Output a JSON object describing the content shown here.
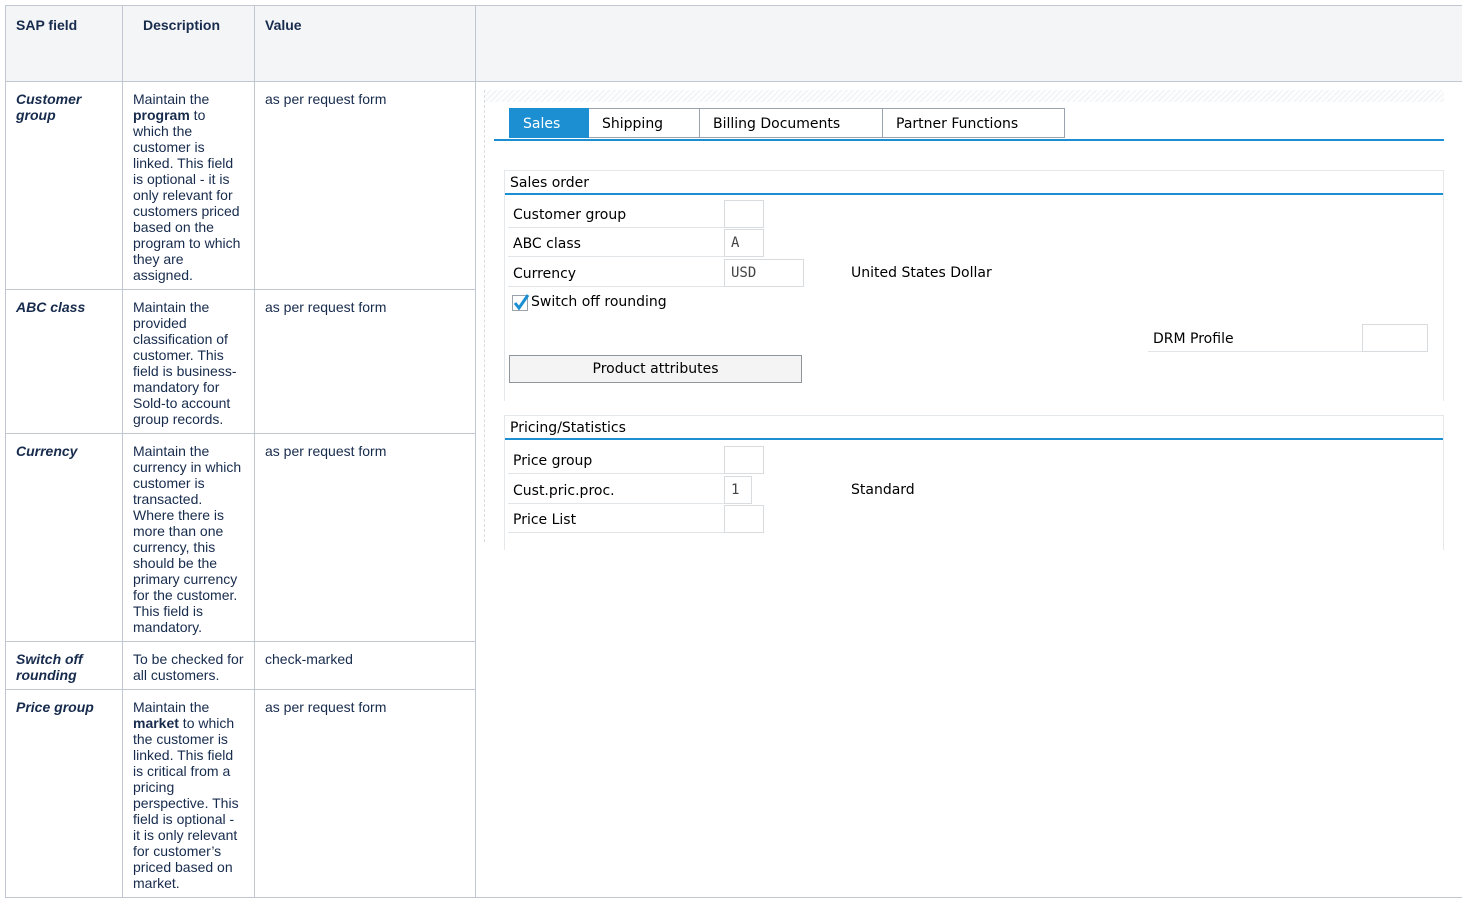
{
  "table": {
    "headers": [
      "SAP field",
      "Description",
      "Value"
    ],
    "rows": [
      {
        "field": "Customer group",
        "desc": [
          "Maintain the ",
          "program",
          " to which the customer is linked. This field is optional - it is only relevant for customers priced based on the program to which they are assigned."
        ],
        "value": "as per request form"
      },
      {
        "field": "ABC class",
        "desc": [
          "Maintain the provided classification of customer. This field is business-mandatory for Sold-to account group records."
        ],
        "value": "as per request form"
      },
      {
        "field": "Currency",
        "desc": [
          "Maintain the currency in which customer is transacted. Where there is more than one currency, this should be the primary currency for the customer. This field is mandatory."
        ],
        "value": "as per request form"
      },
      {
        "field": "Switch off rounding",
        "desc": [
          "To be checked for all customers."
        ],
        "value": "check-marked"
      },
      {
        "field": "Price group",
        "desc": [
          "Maintain the ",
          "market",
          " to which the customer is linked. This field is critical from a pricing perspective. This field is optional - it is only relevant for customer’s priced based on market."
        ],
        "value": "as per request form"
      }
    ]
  },
  "sap": {
    "tabs": [
      "Sales",
      "Shipping",
      "Billing Documents",
      "Partner Functions"
    ],
    "active_tab": "Sales",
    "sales_order": {
      "title": "Sales order",
      "customer_group_label": "Customer group",
      "customer_group_value": "",
      "abc_class_label": "ABC class",
      "abc_class_value": "A",
      "currency_label": "Currency",
      "currency_value": "USD",
      "currency_desc": "United States Dollar",
      "switch_off_rounding_label": "Switch off rounding",
      "switch_off_rounding_checked": true,
      "drm_profile_label": "DRM Profile",
      "drm_profile_value": "",
      "product_attributes_button": "Product attributes"
    },
    "pricing": {
      "title": "Pricing/Statistics",
      "price_group_label": "Price group",
      "price_group_value": "",
      "cust_pric_proc_label": "Cust.pric.proc.",
      "cust_pric_proc_value": "1",
      "cust_pric_proc_desc": "Standard",
      "price_list_label": "Price List",
      "price_list_value": ""
    }
  },
  "colors": {
    "accent": "#1b8fd2",
    "check": "#1b8fd2",
    "header_bg": "#f4f5f7"
  }
}
